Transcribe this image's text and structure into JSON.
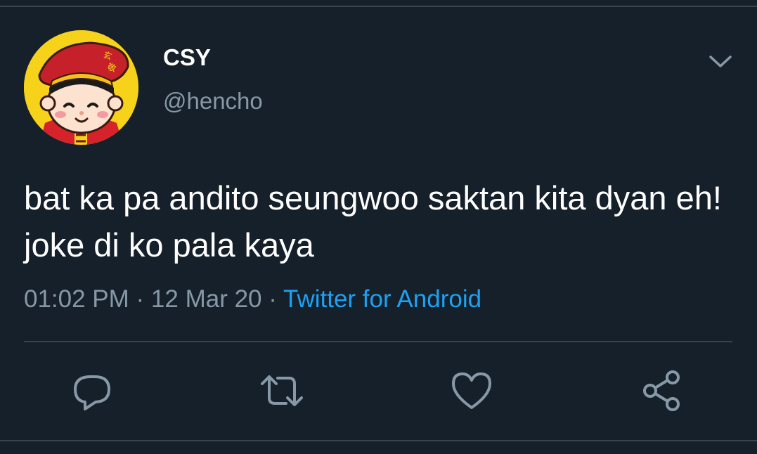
{
  "tweet": {
    "author": {
      "display_name": "CSY",
      "handle": "@hencho",
      "avatar_icon": "cartoon-chef-avatar",
      "avatar_glyphs": "玄敬"
    },
    "text": "bat ka pa andito seungwoo saktan kita dyan eh! joke di ko pala kaya",
    "time": "01:02 PM",
    "separator": " · ",
    "date": "12 Mar 20",
    "source": "Twitter for Android"
  },
  "actions": [
    {
      "name": "reply",
      "icon": "reply-icon"
    },
    {
      "name": "retweet",
      "icon": "retweet-icon"
    },
    {
      "name": "like",
      "icon": "heart-icon"
    },
    {
      "name": "share",
      "icon": "share-icon"
    }
  ],
  "colors": {
    "background": "#15202b",
    "text_primary": "#ffffff",
    "text_secondary": "#8899a6",
    "link": "#1da1f2",
    "divider": "#38444d",
    "avatar_bg": "#f7d21a"
  }
}
